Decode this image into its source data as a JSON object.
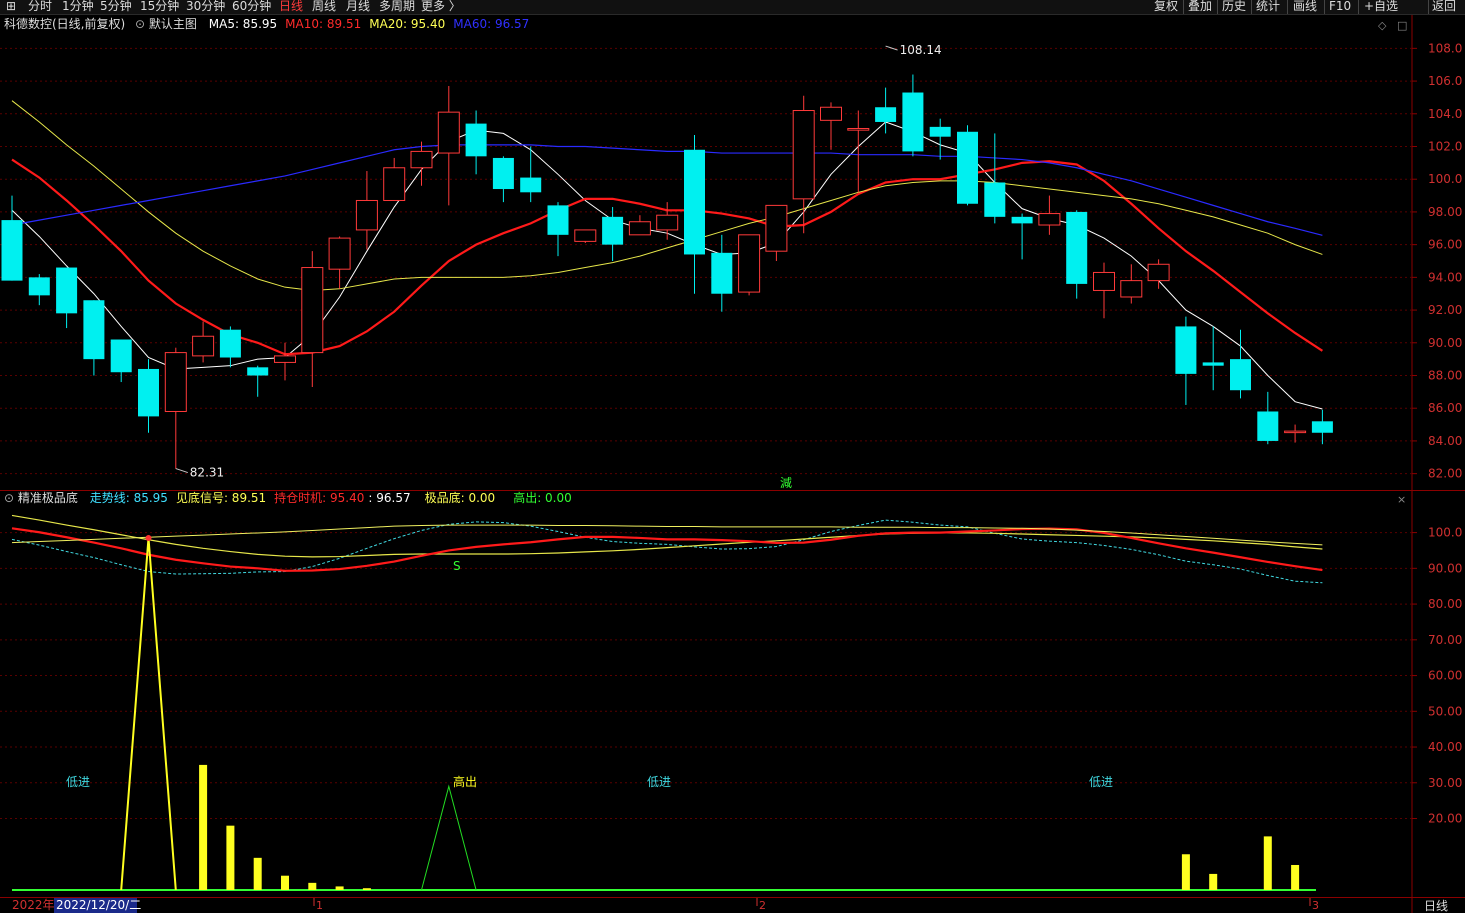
{
  "toolbar": {
    "left_items": [
      {
        "label": "分时",
        "active": false
      },
      {
        "label": "1分钟",
        "active": false
      },
      {
        "label": "5分钟",
        "active": false
      },
      {
        "label": "15分钟",
        "active": false
      },
      {
        "label": "30分钟",
        "active": false
      },
      {
        "label": "60分钟",
        "active": false
      },
      {
        "label": "日线",
        "active": true
      },
      {
        "label": "周线",
        "active": false
      },
      {
        "label": "月线",
        "active": false
      },
      {
        "label": "多周期",
        "active": false
      },
      {
        "label": "更多",
        "active": false
      }
    ],
    "more_arrow": "〉",
    "right_items": [
      "复权",
      "叠加",
      "历史",
      "统计",
      "画线",
      "F10",
      "+自选",
      "返回"
    ]
  },
  "main_panel": {
    "stock_title": "科德数控(日线,前复权)",
    "template": "默认主图",
    "ma": [
      {
        "label": "MA5: 85.95",
        "color": "#ffffff"
      },
      {
        "label": "MA10: 89.51",
        "color": "#ff2b2b"
      },
      {
        "label": "MA20: 95.40",
        "color": "#ffff55"
      },
      {
        "label": "MA60: 96.57",
        "color": "#3030ff"
      }
    ],
    "high_marker": "108.14",
    "low_marker": "82.31",
    "reduce_marker": "減",
    "y_ticks": [
      "108.0",
      "106.0",
      "104.0",
      "102.0",
      "100.0",
      "98.00",
      "96.00",
      "94.00",
      "92.00",
      "90.00",
      "88.00",
      "86.00",
      "84.00",
      "82.00"
    ]
  },
  "indicator_panel": {
    "name": "精准极品底",
    "values": [
      {
        "label": "走势线: 85.95",
        "color": "#40e0ff"
      },
      {
        "label": "见底信号: 89.51",
        "color": "#ffff55"
      },
      {
        "label": "持仓时机: 95.40",
        "color": "#ff2b2b"
      },
      {
        "label": ": 96.57",
        "color": "#ffffff"
      },
      {
        "label": "极品底: 0.00",
        "color": "#ffff55"
      },
      {
        "label": "高出: 0.00",
        "color": "#33ff33"
      }
    ],
    "annotations": [
      "低进",
      "高出",
      "低进",
      "低进",
      "S"
    ],
    "y_ticks": [
      "100.0",
      "90.00",
      "80.00",
      "70.00",
      "60.00",
      "50.00",
      "40.00",
      "30.00",
      "20.00"
    ]
  },
  "bottom_axis": {
    "year": "2022年",
    "cursor_date": "2022/12/20/二",
    "month_marks": [
      "1",
      "2",
      "3"
    ],
    "period": "日线"
  },
  "chart_data": {
    "type": "candlestick",
    "ylim": [
      81,
      109
    ],
    "candles": [
      [
        97.5,
        93.8,
        99.0,
        93.8
      ],
      [
        94,
        92.9,
        94.2,
        92.3
      ],
      [
        94.6,
        91.8,
        94.6,
        90.9
      ],
      [
        92.6,
        89,
        92.6,
        88
      ],
      [
        90.2,
        88.2,
        90.2,
        87.6
      ],
      [
        88.4,
        85.5,
        89,
        84.5
      ],
      [
        85.8,
        89.4,
        89.7,
        82.3
      ],
      [
        89.2,
        90.4,
        91.3,
        88.8
      ],
      [
        90.8,
        89.1,
        91,
        88.5
      ],
      [
        88.5,
        88,
        88.6,
        86.7
      ],
      [
        88.8,
        89.2,
        90,
        87.7
      ],
      [
        89.4,
        94.6,
        95.6,
        87.3
      ],
      [
        94.5,
        96.4,
        96.5,
        93.3
      ],
      [
        96.9,
        98.7,
        100.5,
        95.7
      ],
      [
        98.7,
        100.7,
        101.3,
        98.7
      ],
      [
        100.7,
        101.7,
        102.3,
        99.6
      ],
      [
        101.6,
        104.1,
        105.7,
        98.4
      ],
      [
        103.4,
        101.4,
        104.2,
        100.3
      ],
      [
        101.3,
        99.4,
        101.4,
        98.6
      ],
      [
        100.1,
        99.2,
        102.0,
        98.6
      ],
      [
        98.4,
        96.6,
        98.6,
        95.3
      ],
      [
        96.2,
        96.9,
        96.9,
        96.1
      ],
      [
        97.7,
        96,
        98.3,
        95.0
      ],
      [
        96.6,
        97.4,
        97.8,
        96.6
      ],
      [
        96.9,
        97.8,
        98.6,
        96.3
      ],
      [
        101.8,
        95.4,
        102.7,
        93.0
      ],
      [
        95.5,
        93.0,
        96.6,
        91.9
      ],
      [
        93.1,
        96.6,
        96.6,
        92.9
      ],
      [
        95.6,
        98.4,
        98.4,
        95.0
      ],
      [
        98.8,
        104.2,
        105.1,
        96.7
      ],
      [
        103.6,
        104.4,
        104.7,
        101.8
      ],
      [
        103.0,
        103.1,
        104.2,
        99.2
      ],
      [
        104.4,
        103.5,
        105.6,
        102.8
      ],
      [
        105.3,
        101.7,
        106.4,
        101.4
      ],
      [
        103.2,
        102.6,
        103.7,
        101.2
      ],
      [
        102.9,
        98.5,
        103.3,
        98.4
      ],
      [
        99.8,
        97.7,
        102.8,
        97.3
      ],
      [
        97.7,
        97.3,
        97.9,
        95.1
      ],
      [
        97.2,
        97.9,
        99.0,
        96.6
      ],
      [
        98.0,
        93.6,
        98.1,
        92.7
      ],
      [
        93.2,
        94.3,
        94.9,
        91.5
      ],
      [
        92.8,
        93.8,
        94.8,
        92.4
      ],
      [
        93.8,
        94.8,
        95.1,
        93.3
      ],
      [
        91.0,
        88.1,
        91.6,
        86.2
      ],
      [
        88.8,
        88.6,
        91.0,
        87.1
      ],
      [
        89.0,
        87.1,
        90.8,
        86.6
      ],
      [
        85.8,
        84.0,
        87.0,
        83.8
      ],
      [
        84.6,
        84.6,
        85.0,
        83.9
      ],
      [
        85.2,
        84.5,
        85.9,
        83.8
      ]
    ],
    "series": [
      {
        "name": "MA5",
        "values": [
          98.1,
          96.5,
          94.7,
          93.0,
          91.0,
          89.1,
          88.4,
          88.5,
          88.6,
          89.0,
          89.1,
          90.5,
          92.8,
          95.6,
          98.3,
          100.6,
          102.3,
          103.0,
          102.8,
          101.8,
          100.3,
          98.7,
          97.5,
          97.0,
          96.7,
          96.0,
          95.4,
          95.5,
          96.1,
          98.0,
          100.3,
          102.0,
          103.5,
          102.9,
          102.1,
          101.6,
          99.8,
          98.2,
          97.6,
          97.2,
          96.4,
          95.3,
          93.8,
          92.0,
          91.0,
          89.8,
          88.0,
          86.4,
          85.95
        ]
      },
      {
        "name": "MA10",
        "values": [
          101.2,
          100.1,
          98.7,
          97.2,
          95.6,
          93.8,
          92.4,
          91.4,
          90.5,
          90.0,
          89.3,
          89.4,
          89.8,
          90.7,
          91.9,
          93.5,
          95.0,
          96.0,
          96.7,
          97.3,
          98.1,
          98.8,
          98.8,
          98.5,
          98.1,
          98.1,
          97.9,
          97.6,
          97.1,
          97.2,
          98.0,
          99.1,
          99.8,
          100.0,
          100.0,
          100.3,
          100.6,
          101.0,
          101.1,
          100.9,
          99.9,
          98.5,
          97.0,
          95.6,
          94.4,
          93.1,
          91.8,
          90.6,
          89.51
        ]
      },
      {
        "name": "MA20",
        "values": [
          104.8,
          103.5,
          102.1,
          100.8,
          99.4,
          98.0,
          96.7,
          95.6,
          94.7,
          93.9,
          93.4,
          93.2,
          93.3,
          93.6,
          93.9,
          94.0,
          94.0,
          94.0,
          94.0,
          94.1,
          94.3,
          94.6,
          94.9,
          95.3,
          95.8,
          96.3,
          96.8,
          97.3,
          97.7,
          98.2,
          98.7,
          99.2,
          99.6,
          99.8,
          99.9,
          99.9,
          99.8,
          99.6,
          99.4,
          99.2,
          99.0,
          98.8,
          98.5,
          98.1,
          97.7,
          97.2,
          96.7,
          96.0,
          95.4
        ]
      },
      {
        "name": "MA60",
        "values": [
          97.2,
          97.5,
          97.8,
          98.1,
          98.4,
          98.7,
          99.0,
          99.3,
          99.6,
          99.9,
          100.2,
          100.6,
          101.0,
          101.4,
          101.8,
          102.0,
          102.1,
          102.1,
          102.1,
          102.1,
          102.0,
          102.0,
          101.9,
          101.8,
          101.7,
          101.7,
          101.6,
          101.6,
          101.6,
          101.6,
          101.6,
          101.5,
          101.5,
          101.5,
          101.4,
          101.4,
          101.3,
          101.2,
          101.0,
          100.7,
          100.3,
          99.9,
          99.4,
          98.9,
          98.4,
          97.9,
          97.4,
          97.0,
          96.57
        ]
      }
    ],
    "indicator": {
      "ylim": [
        0,
        108
      ],
      "bars": [
        [
          7,
          35
        ],
        [
          8,
          18
        ],
        [
          9,
          9
        ],
        [
          10,
          4
        ],
        [
          11,
          2
        ],
        [
          12,
          1
        ],
        [
          13,
          0.5
        ],
        [
          43,
          10
        ],
        [
          44,
          4.5
        ],
        [
          46,
          15
        ],
        [
          47,
          7
        ]
      ],
      "signal_peak_index": 5,
      "signal_peak_value": 98.5,
      "gao_chu_peak_index": 16,
      "gao_chu_peak_value": 29
    }
  }
}
